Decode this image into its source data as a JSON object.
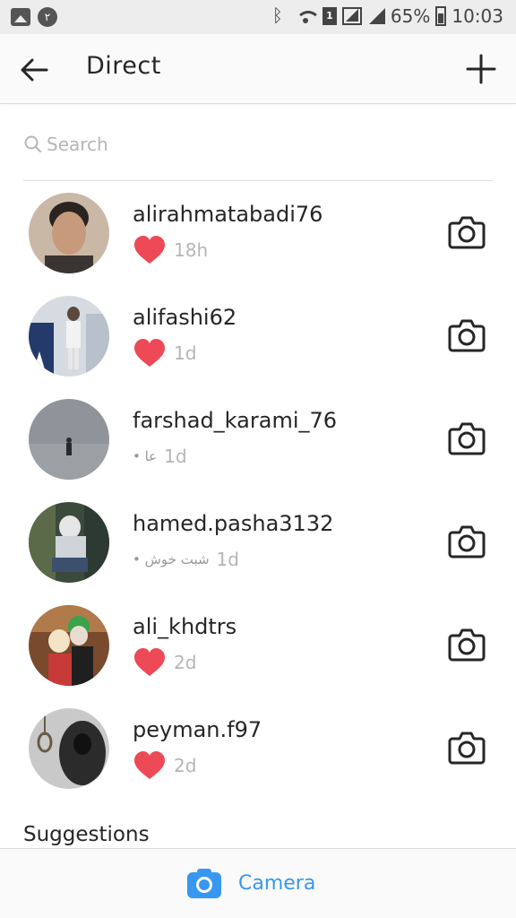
{
  "status_bar": {
    "notification_count": "۲",
    "sim_label": "1",
    "battery_percent": "65%",
    "time": "10:03"
  },
  "header": {
    "title": "Direct"
  },
  "search": {
    "placeholder": "Search"
  },
  "threads": [
    {
      "username": "alirahmatabadi76",
      "preview": "",
      "time": "18h",
      "has_heart": true
    },
    {
      "username": "alifashi62",
      "preview": "",
      "time": "1d",
      "has_heart": true
    },
    {
      "username": "farshad_karami_76",
      "preview": "عا •",
      "time": "1d",
      "has_heart": false
    },
    {
      "username": "hamed.pasha3132",
      "preview": "شبت خوش •",
      "time": "1d",
      "has_heart": false
    },
    {
      "username": "ali_khdtrs",
      "preview": "",
      "time": "2d",
      "has_heart": true
    },
    {
      "username": "peyman.f97",
      "preview": "",
      "time": "2d",
      "has_heart": true
    }
  ],
  "suggestions": {
    "title": "Suggestions"
  },
  "bottom_bar": {
    "camera_label": "Camera"
  },
  "colors": {
    "accent": "#3897f0",
    "heart": "#ed4956",
    "text": "#262626",
    "muted": "#b5b5b5"
  }
}
